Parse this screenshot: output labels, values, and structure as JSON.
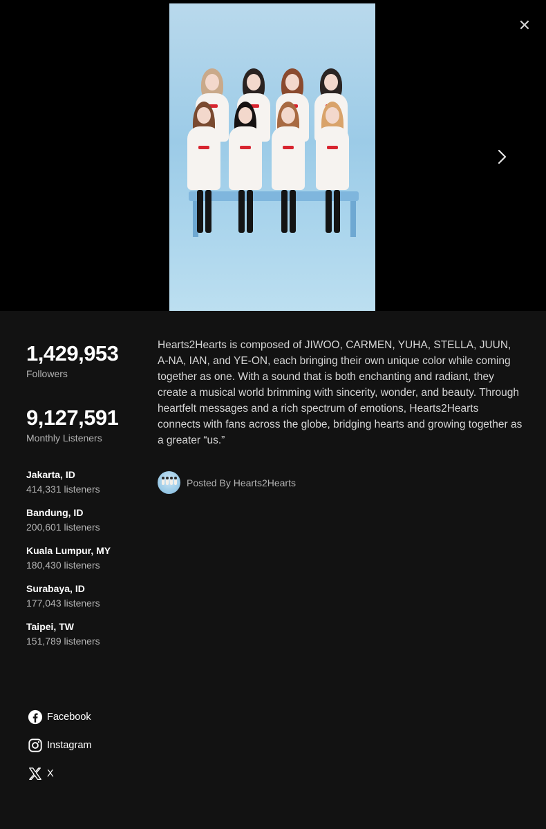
{
  "hero": {
    "close_glyph": "✕",
    "next_icon": "chevron-right-icon"
  },
  "stats": {
    "followers_count": "1,429,953",
    "followers_label": "Followers",
    "monthly_count": "9,127,591",
    "monthly_label": "Monthly Listeners"
  },
  "cities": [
    {
      "name": "Jakarta, ID",
      "listeners": "414,331 listeners"
    },
    {
      "name": "Bandung, ID",
      "listeners": "200,601 listeners"
    },
    {
      "name": "Kuala Lumpur, MY",
      "listeners": "180,430 listeners"
    },
    {
      "name": "Surabaya, ID",
      "listeners": "177,043 listeners"
    },
    {
      "name": "Taipei, TW",
      "listeners": "151,789 listeners"
    }
  ],
  "bio": {
    "text": "Hearts2Hearts is composed of JIWOO, CARMEN, YUHA, STELLA, JUUN, A-NA, IAN, and YE-ON, each bringing their own unique color while coming together as one. With a sound that is both enchanting and radiant, they create a musical world brimming with sincerity, wonder, and beauty. Through heartfelt messages and a rich spectrum of emotions, Hearts2Hearts connects with fans across the globe, bridging hearts and growing together as a greater “us.”",
    "posted_by": "Posted By Hearts2Hearts"
  },
  "socials": [
    {
      "label": "Facebook",
      "icon": "facebook-icon"
    },
    {
      "label": "Instagram",
      "icon": "instagram-icon"
    },
    {
      "label": "X",
      "icon": "x-icon"
    }
  ],
  "colors": {
    "background": "#121212",
    "hero_background": "#000000",
    "photo_sky": "#9ccbe7",
    "secondary_text": "#b3b3b3"
  }
}
